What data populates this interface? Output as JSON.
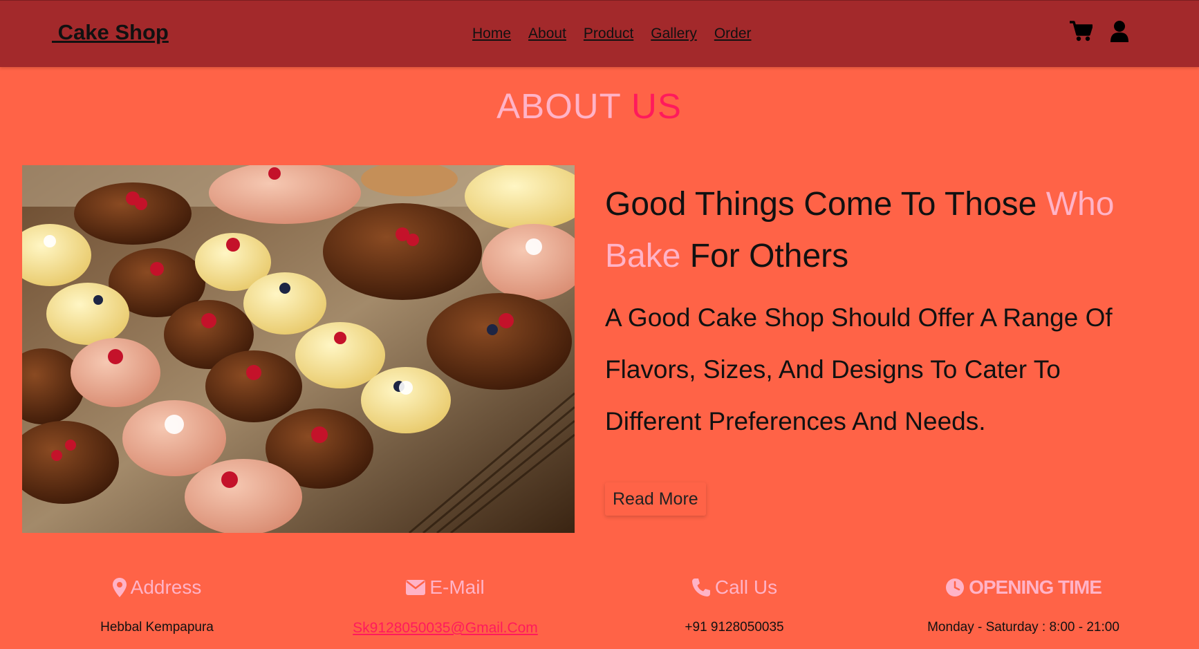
{
  "header": {
    "logo": " Cake Shop",
    "nav": [
      "Home",
      "About",
      "Product",
      "Gallery",
      "Order"
    ],
    "icons": [
      "cart-icon",
      "user-icon"
    ]
  },
  "about": {
    "title_part1": "ABOUT ",
    "title_part2": "US",
    "headline": {
      "part1": "Good Things Come To Those ",
      "part2": "Who Bake",
      "part3": " For Others"
    },
    "description": "A Good Cake Shop Should Offer A Range Of Flavors, Sizes, And Designs To Cater To Different Preferences And Needs.",
    "button": "Read More"
  },
  "contact": [
    {
      "icon": "map-marker-icon",
      "label": "Address",
      "value": "Hebbal Kempapura"
    },
    {
      "icon": "envelope-icon",
      "label": "E-Mail",
      "value": "Sk9128050035@Gmail.Com"
    },
    {
      "icon": "phone-icon",
      "label": "Call Us",
      "value": "+91 9128050035"
    },
    {
      "icon": "clock-icon",
      "label": "OPENING TIME",
      "value": "Monday - Saturday : 8:00 - 21:00"
    }
  ],
  "colors": {
    "background": "#ff6347",
    "navbar": "#a3292b",
    "accent_pink": "#ffb3c7",
    "accent_red": "#ff1a5c"
  }
}
